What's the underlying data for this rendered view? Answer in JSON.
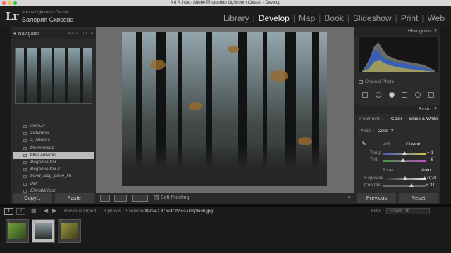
{
  "window": {
    "title": "A и A.lrcat - Adobe Photoshop Lightroom Classic - Develop"
  },
  "colors": {
    "close": "#ff5f57",
    "minimize": "#febc2e",
    "maximize": "#28c840"
  },
  "identity": {
    "logo": "Lr",
    "app": "Adobe Lightroom Classic",
    "user": "Валерия Скисова"
  },
  "modules": [
    {
      "label": "Library",
      "active": false
    },
    {
      "label": "Develop",
      "active": true
    },
    {
      "label": "Map",
      "active": false
    },
    {
      "label": "Book",
      "active": false
    },
    {
      "label": "Slideshow",
      "active": false
    },
    {
      "label": "Print",
      "active": false
    },
    {
      "label": "Web",
      "active": false
    }
  ],
  "navigator": {
    "title": "Navigator",
    "options": "FIT  FILL  1:1  1:4"
  },
  "presets": [
    {
      "label": "яхтыл",
      "selected": false
    },
    {
      "label": "яхтымой",
      "selected": false
    },
    {
      "label": "a_Millena",
      "selected": false
    },
    {
      "label": "bloommood",
      "selected": false
    },
    {
      "label": "blue autumn",
      "selected": true
    },
    {
      "label": "Bogemia KH",
      "selected": false
    },
    {
      "label": "Bogemia KH 2",
      "selected": false
    },
    {
      "label": "bond_lady_prew_kh",
      "selected": false
    },
    {
      "label": "def",
      "selected": false
    },
    {
      "label": "ElenaWillson",
      "selected": false
    }
  ],
  "left_buttons": {
    "copy": "Copy...",
    "paste": "Paste"
  },
  "toolbar": {
    "soft_proofing": "Soft Proofing"
  },
  "histogram": {
    "title": "Histogram",
    "original_photo": "Original Photo"
  },
  "basic": {
    "title": "Basic",
    "treatment_label": "Treatment :",
    "treatment_color": "Color",
    "treatment_bw": "Black & White",
    "profile_label": "Profile :",
    "profile_value": "Color",
    "wb_label": "WB :",
    "wb_value": "Custom",
    "temp_label": "Temp",
    "temp_value": "+ 1",
    "tint_label": "Tint",
    "tint_value": "– 6",
    "tone_label": "Tone",
    "tone_auto": "Auto",
    "exposure_label": "Exposure",
    "exposure_value": "+ 0,20",
    "contrast_label": "Contrast",
    "contrast_value": "+ 31"
  },
  "right_buttons": {
    "previous": "Previous",
    "reset": "Reset"
  },
  "filmstrip_bar": {
    "page1": "1",
    "page2": "2",
    "source": "Previous Import",
    "status": "3 photos / 1 selected /",
    "filename": "b-nw-zJCRuCJV5ls-unsplash.jpg",
    "filter_label": "Filter :",
    "filter_value": "Filters Off"
  },
  "thumbnails": [
    {
      "num": "1",
      "selected": false,
      "tint": "#4d7a2e"
    },
    {
      "num": "2",
      "selected": true,
      "tint": "#5a6660"
    },
    {
      "num": "3",
      "selected": false,
      "tint": "#6e6a2a"
    }
  ]
}
